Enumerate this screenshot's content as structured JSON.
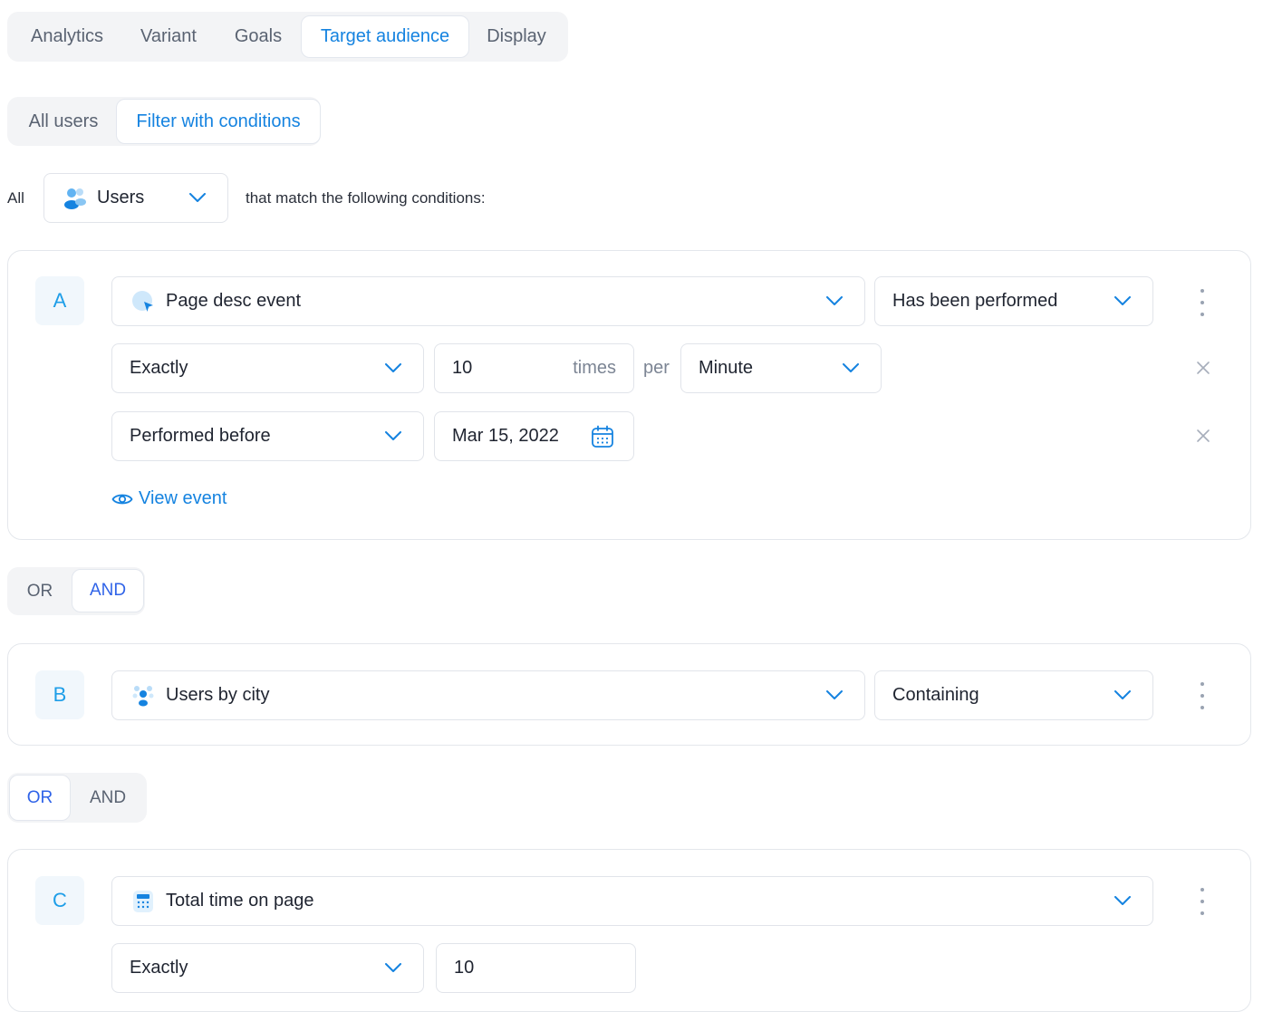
{
  "tabs": [
    {
      "label": "Analytics"
    },
    {
      "label": "Variant"
    },
    {
      "label": "Goals"
    },
    {
      "label": "Target audience",
      "active": true
    },
    {
      "label": "Display"
    }
  ],
  "audience_mode": {
    "options": [
      "All users",
      "Filter with conditions"
    ],
    "selected": "Filter with conditions"
  },
  "match_row": {
    "prefix": "All",
    "entity_select": "Users",
    "entity_icon": "users-icon",
    "suffix": "that match the following conditions:"
  },
  "condition_a": {
    "badge": "A",
    "event_icon": "cursor-click-icon",
    "event_select": "Page desc event",
    "operator_select": "Has been performed",
    "frequency": {
      "mode_select": "Exactly",
      "count_value": "10",
      "count_unit": "times",
      "per_label": "per",
      "period_select": "Minute"
    },
    "time": {
      "mode_select": "Performed before",
      "date_value": "Mar 15, 2022",
      "calendar_icon": "calendar-icon"
    },
    "view_event_label": "View event",
    "view_event_icon": "eye-icon"
  },
  "join_1": {
    "options": [
      "OR",
      "AND"
    ],
    "selected": "AND"
  },
  "condition_b": {
    "badge": "B",
    "attribute_icon": "users-group-icon",
    "attribute_select": "Users by city",
    "operator_select": "Containing"
  },
  "join_2": {
    "options": [
      "OR",
      "AND"
    ],
    "selected": "OR"
  },
  "condition_c": {
    "badge": "C",
    "metric_icon": "calculator-icon",
    "metric_select": "Total time on page",
    "mode_select": "Exactly",
    "value": "10"
  },
  "colors": {
    "accent": "#1583e0",
    "accent_strong": "#2f63e8",
    "badge_text": "#1e9ee8",
    "border": "#e1e4ea",
    "muted_text": "#7c8594"
  }
}
